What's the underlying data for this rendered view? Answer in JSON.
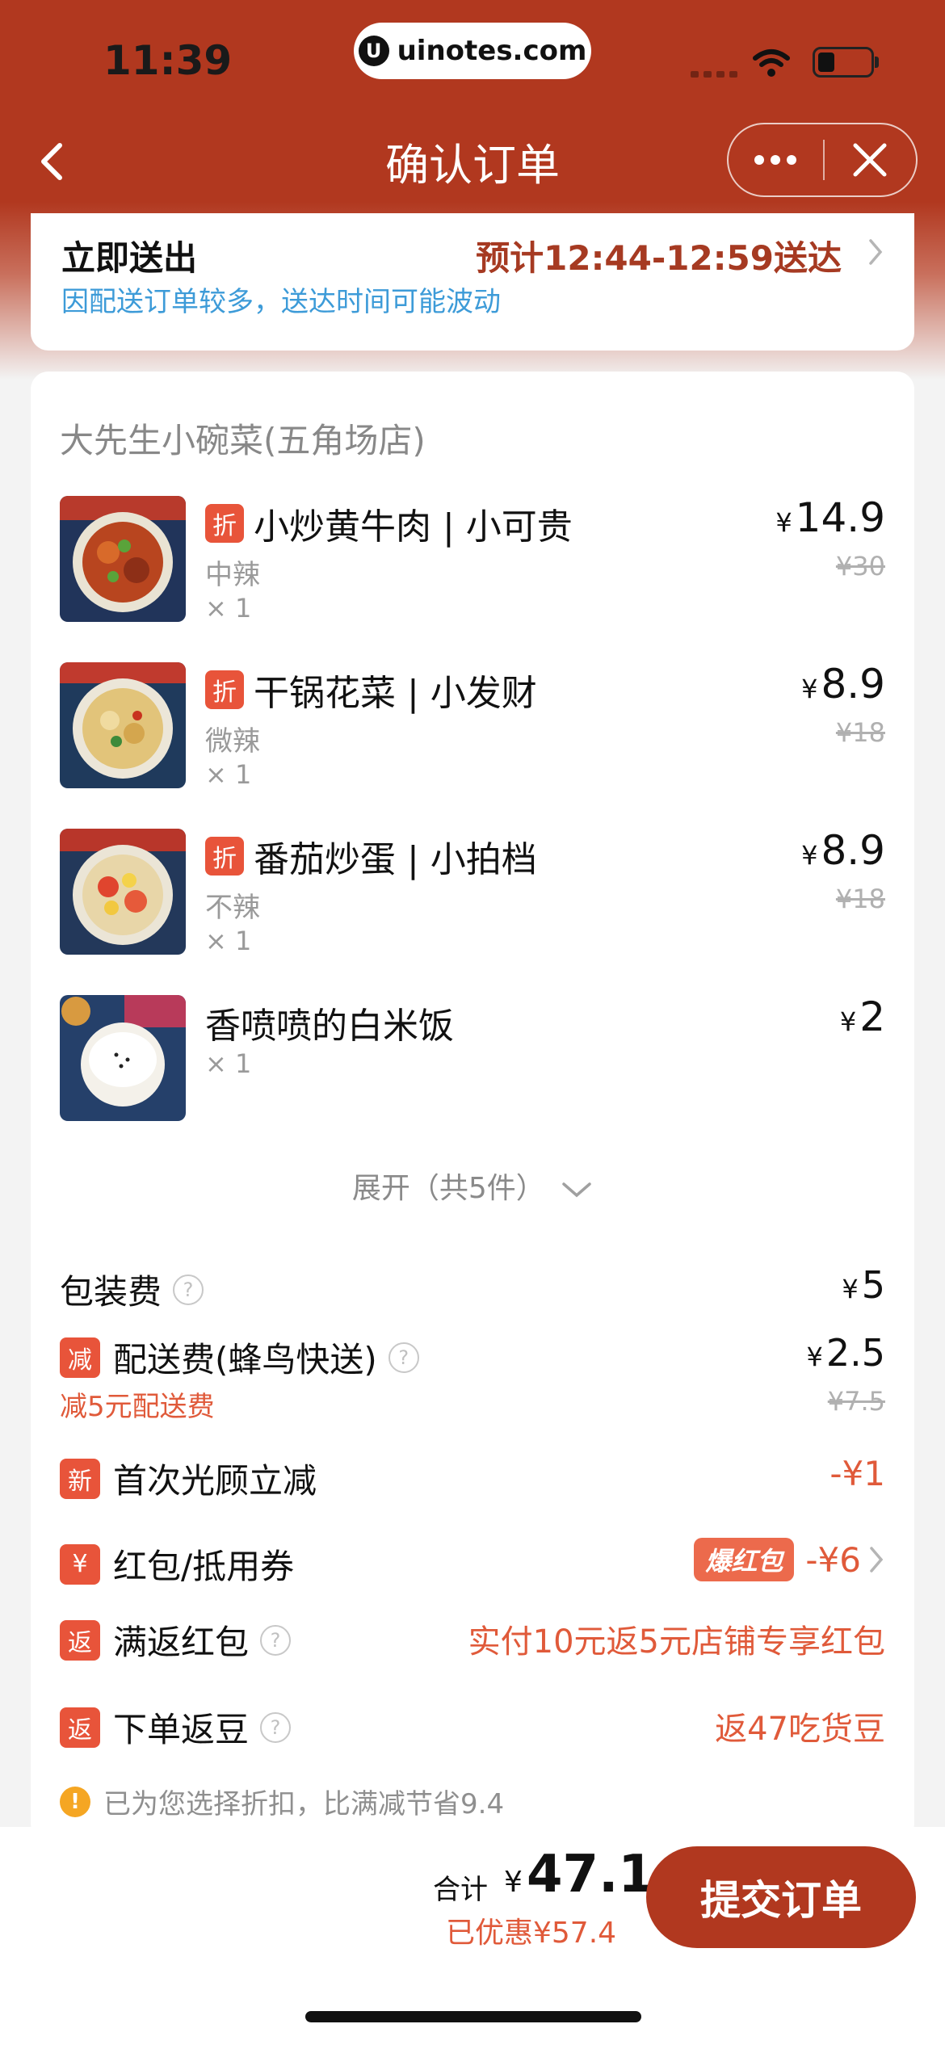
{
  "status_bar": {
    "time": "11:39",
    "url": "uinotes.com",
    "url_logo": "U"
  },
  "nav": {
    "title": "确认订单",
    "more_icon": "more-dots-icon",
    "close_icon": "close-icon",
    "back_icon": "back-chevron-icon"
  },
  "delivery": {
    "mode": "立即送出",
    "eta": "预计12:44-12:59送达",
    "note": "因配送订单较多，送达时间可能波动"
  },
  "shop": {
    "name": "大先生小碗菜(五角场店)"
  },
  "items": [
    {
      "tag": "折",
      "name": "小炒黄牛肉 | 小可贵",
      "spec": "中辣",
      "qty": "× 1",
      "price": "14.9",
      "original": "¥30"
    },
    {
      "tag": "折",
      "name": "干锅花菜 | 小发财",
      "spec": "微辣",
      "qty": "× 1",
      "price": "8.9",
      "original": "¥18"
    },
    {
      "tag": "折",
      "name": "番茄炒蛋 | 小拍档",
      "spec": "不辣",
      "qty": "× 1",
      "price": "8.9",
      "original": "¥18"
    },
    {
      "tag": "",
      "name": "香喷喷的白米饭",
      "spec": "",
      "qty": "× 1",
      "price": "2",
      "original": ""
    }
  ],
  "expand_label": "展开（共5件）",
  "currency": "¥",
  "fees": {
    "packaging_label": "包装费",
    "packaging_value": "5",
    "delivery_badge": "减",
    "delivery_label": "配送费(蜂鸟快送)",
    "delivery_value": "2.5",
    "delivery_orig": "¥7.5",
    "delivery_discount": "减5元配送费",
    "first_badge": "新",
    "first_label": "首次光顾立减",
    "first_value": "-¥1",
    "coupon_badge": "¥",
    "coupon_label": "红包/抵用券",
    "coupon_tag": "爆红包",
    "coupon_value": "-¥6",
    "cashback_badge": "返",
    "cashback_label": "满返红包",
    "cashback_value": "实付10元返5元店铺专享红包",
    "beans_badge": "返",
    "beans_label": "下单返豆",
    "beans_value": "返47吃货豆"
  },
  "tip": {
    "icon": "!",
    "text": "已为您选择折扣，比满减节省9.4"
  },
  "bottom": {
    "total_label": "合计",
    "total_yen": "¥",
    "total_amount": "47.1",
    "saved": "已优惠¥57.4",
    "submit": "提交订单"
  },
  "colors": {
    "brand": "#b1381f",
    "accent_red": "#e8543a",
    "link_blue": "#3d9bd8"
  }
}
